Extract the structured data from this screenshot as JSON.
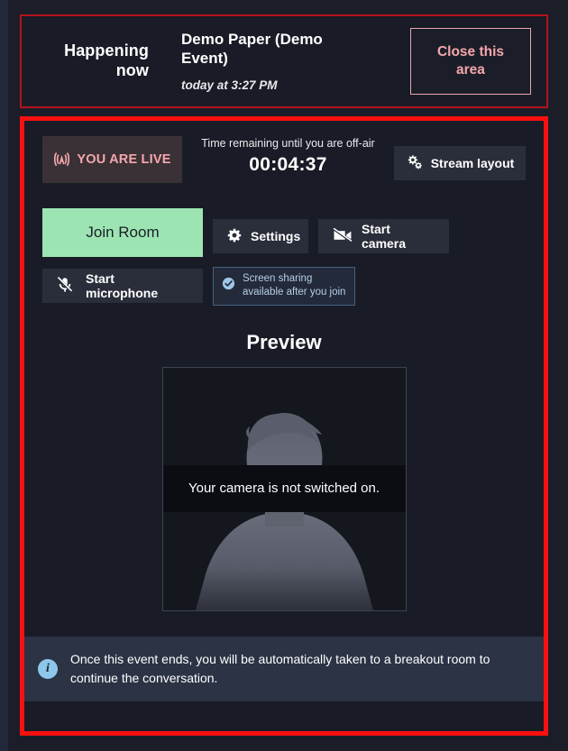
{
  "header": {
    "happening_label": "Happening\nnow",
    "happening_label_line1": "Happening",
    "happening_label_line2": "now",
    "event_title": "Demo Paper (Demo Event)",
    "event_time": "today at 3:27 PM",
    "close_button_line1": "Close this",
    "close_button_line2": "area",
    "close_button_label": "Close this area"
  },
  "status": {
    "live_badge_label": "YOU ARE LIVE",
    "live_badge_icon": "broadcast-icon",
    "timer_label": "Time remaining until you are off-air",
    "timer_value": "00:04:37",
    "stream_layout_label": "Stream layout",
    "stream_layout_icon": "gears-icon"
  },
  "controls": {
    "join_room_label": "Join Room",
    "settings_label": "Settings",
    "settings_icon": "gear-icon",
    "start_camera_label": "Start camera",
    "start_camera_icon": "camera-off-icon",
    "start_microphone_label": "Start microphone",
    "start_microphone_icon": "microphone-off-icon",
    "share_note_line1": "Screen sharing available",
    "share_note_line2": "after you join",
    "share_note_icon": "check-circle-icon"
  },
  "preview": {
    "title": "Preview",
    "camera_off_message": "Your camera is not switched on."
  },
  "footer": {
    "info_icon": "info-icon",
    "info_message": "Once this event ends, you will be automatically taken to a breakout room to continue the conversation."
  },
  "colors": {
    "page_background": "#1b1e28",
    "panel_background": "#191c26",
    "header_border": "#b4121d",
    "live_panel_border": "#fa1010",
    "accent_pink": "#f4a7ad",
    "join_green": "#9ce5b3",
    "button_dark": "#2a2e3b",
    "info_bar": "#2b3344",
    "info_blue": "#8ec7ec",
    "share_note_text": "#b6cfe8",
    "share_note_border": "#47617d"
  }
}
